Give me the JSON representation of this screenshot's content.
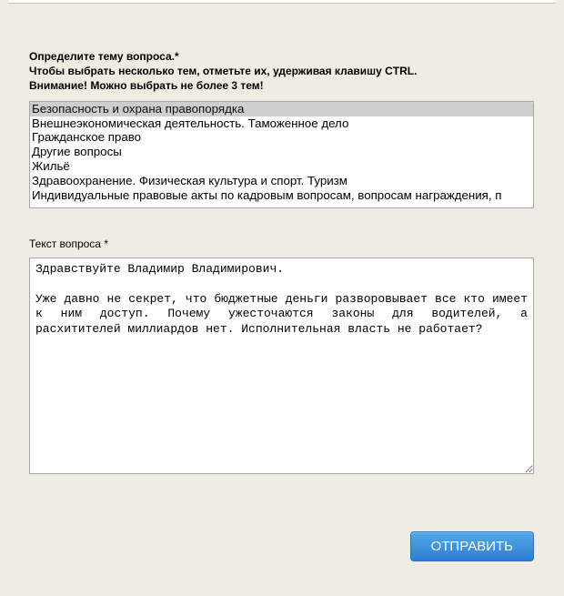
{
  "instructions": {
    "line1": "Определите тему вопроса.*",
    "line2": "Чтобы выбрать несколько тем, отметьте их, удерживая клавишу CTRL.",
    "line3": "Внимание! Можно выбрать не более 3 тем!"
  },
  "topic_select": {
    "options": [
      "Безопасность и охрана правопорядка",
      "Внешнеэкономическая деятельность. Таможенное дело",
      "Гражданское право",
      "Другие вопросы",
      "Жильё",
      "Здравоохранение. Физическая культура и спорт. Туризм",
      "Индивидуальные правовые акты по кадровым вопросам, вопросам награждения, п"
    ],
    "selected_index": 0
  },
  "question_label": "Текст вопроса *",
  "question_text": "Здравствуйте Владимир Владимирович.\n\nУже давно не секрет, что бюджетные деньги разворовывает все кто имеет к ним доступ. Почему ужесточаются законы для водителей, а расхитителей миллиардов нет. Исполнительная власть не работает?",
  "submit_label": "ОТПРАВИТЬ"
}
